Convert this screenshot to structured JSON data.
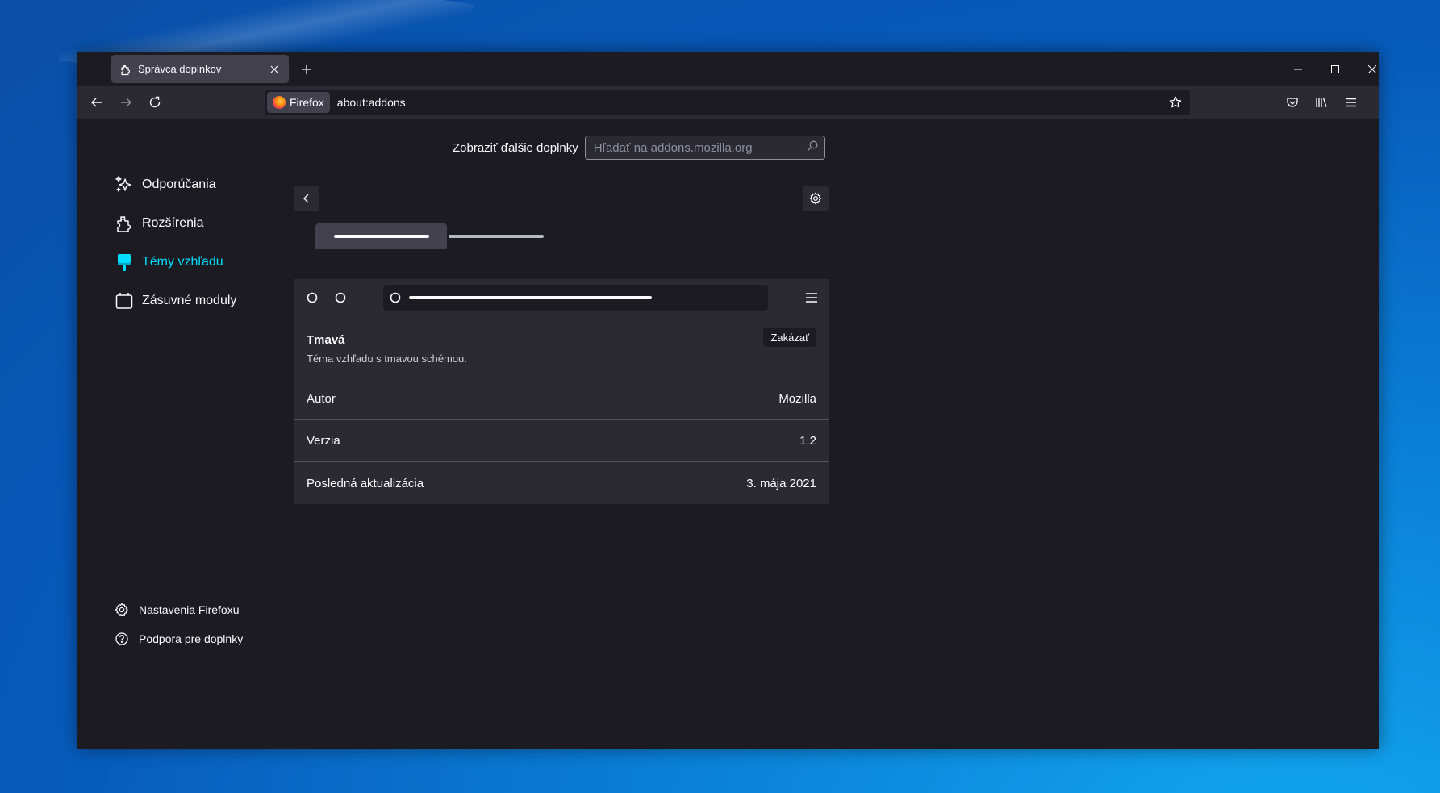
{
  "browser": {
    "tab": {
      "title": "Správca doplnkov",
      "icon": "puzzle-icon"
    },
    "url": "about:addons",
    "identity_label": "Firefox"
  },
  "page": {
    "search": {
      "label": "Zobraziť ďalšie doplnky",
      "placeholder": "Hľadať na addons.mozilla.org"
    },
    "sidebar": [
      {
        "label": "Odporúčania",
        "icon": "sparkle-icon"
      },
      {
        "label": "Rozšírenia",
        "icon": "puzzle-icon"
      },
      {
        "label": "Témy vzhľadu",
        "icon": "brush-icon",
        "active": true
      },
      {
        "label": "Zásuvné moduly",
        "icon": "plugin-icon"
      }
    ],
    "footer": [
      {
        "label": "Nastavenia Firefoxu",
        "icon": "gear-icon"
      },
      {
        "label": "Podpora pre doplnky",
        "icon": "help-icon"
      }
    ],
    "theme": {
      "name": "Tmavá",
      "description": "Téma vzhľadu s tmavou schémou.",
      "disable_label": "Zakázať"
    },
    "details": [
      {
        "label": "Autor",
        "value": "Mozilla"
      },
      {
        "label": "Verzia",
        "value": "1.2"
      },
      {
        "label": "Posledná aktualizácia",
        "value": "3. mája 2021"
      }
    ]
  },
  "colors": {
    "accent": "#00ddff",
    "background": "#1c1b22",
    "surface": "#2b2a33"
  }
}
